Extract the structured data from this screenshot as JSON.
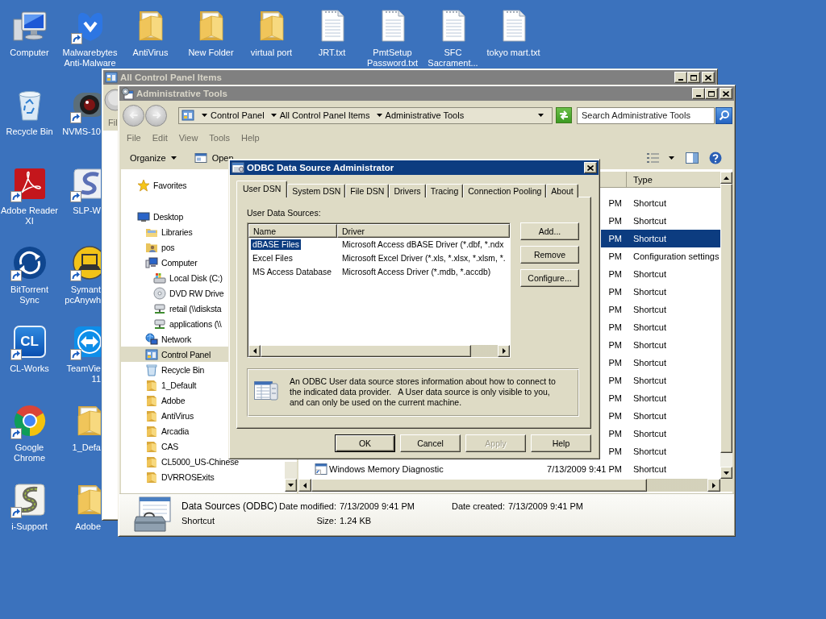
{
  "desktop": {
    "columns": [
      {
        "icons": [
          {
            "label": "Computer",
            "kind": "computer",
            "shortcut": false
          },
          {
            "label": "Recycle Bin",
            "kind": "recycle",
            "shortcut": false
          },
          {
            "label": "Adobe Reader XI",
            "kind": "pdf",
            "shortcut": true
          },
          {
            "label": "BitTorrent Sync",
            "kind": "sync",
            "shortcut": true
          },
          {
            "label": "CL-Works",
            "kind": "tile",
            "logo": "CL",
            "shortcut": true
          },
          {
            "label": "Google Chrome",
            "kind": "chrome",
            "shortcut": true
          },
          {
            "label": "i-Support",
            "kind": "road",
            "shortcut": true
          }
        ]
      },
      {
        "icons": [
          {
            "label": "Malwarebytes Anti-Malware",
            "kind": "emblem",
            "shortcut": true
          },
          {
            "label": "NVMS-10",
            "kind": "camera",
            "shortcut": true
          },
          {
            "label": "SLP-W",
            "kind": "swoosh",
            "shortcut": true
          },
          {
            "label": "Symant pcAnywh",
            "kind": "laptop",
            "shortcut": true
          },
          {
            "label": "TeamVie 11",
            "kind": "arrows",
            "shortcut": true
          },
          {
            "label": "1_Defa",
            "kind": "folder",
            "shortcut": false
          },
          {
            "label": "Adobe",
            "kind": "folder",
            "shortcut": false
          }
        ]
      },
      {
        "icons": [
          {
            "label": "AntiVirus",
            "kind": "folder",
            "shortcut": false
          }
        ]
      },
      {
        "icons": [
          {
            "label": "New Folder",
            "kind": "folder",
            "shortcut": false
          }
        ]
      },
      {
        "icons": [
          {
            "label": "virtual port",
            "kind": "folder",
            "shortcut": false
          }
        ]
      },
      {
        "icons": [
          {
            "label": "JRT.txt",
            "kind": "text",
            "shortcut": false
          }
        ]
      },
      {
        "icons": [
          {
            "label": "PmtSetup Password.txt",
            "kind": "text",
            "shortcut": false
          }
        ]
      },
      {
        "icons": [
          {
            "label": "SFC Sacrament...",
            "kind": "text",
            "shortcut": false
          }
        ]
      },
      {
        "icons": [
          {
            "label": "tokyo mart.txt",
            "kind": "text",
            "shortcut": false
          }
        ]
      }
    ]
  },
  "back_window": {
    "title": "All Control Panel Items",
    "active": false,
    "menu": [
      "Fil"
    ]
  },
  "explorer": {
    "title": "Administrative Tools",
    "active": false,
    "breadcrumb": [
      "Control Panel",
      "All Control Panel Items",
      "Administrative Tools"
    ],
    "search": {
      "placeholder": "Search Administrative Tools"
    },
    "menu": [
      "File",
      "Edit",
      "View",
      "Tools",
      "Help"
    ],
    "toolbar": [
      {
        "label": "Organize",
        "kind": "menu"
      },
      {
        "label": "Open",
        "kind": "open"
      }
    ],
    "nav": [
      {
        "label": "Favorites",
        "kind": "star",
        "selected": false
      },
      {
        "label": "Desktop",
        "kind": "desktop",
        "selected": false,
        "children": [
          {
            "label": "Libraries",
            "kind": "libraries",
            "selected": false
          },
          {
            "label": "pos",
            "kind": "user",
            "selected": false
          },
          {
            "label": "Computer",
            "kind": "computer",
            "selected": false,
            "children": [
              {
                "label": "Local Disk (C:)",
                "kind": "disk",
                "selected": false
              },
              {
                "label": "DVD RW Drive",
                "kind": "dvd",
                "selected": false
              },
              {
                "label": "retail (\\\\disksta",
                "kind": "netdrive",
                "selected": false
              },
              {
                "label": "applications (\\\\",
                "kind": "netdrive",
                "selected": false
              }
            ]
          },
          {
            "label": "Network",
            "kind": "network",
            "selected": false
          },
          {
            "label": "Control Panel",
            "kind": "controlpanel",
            "selected": true
          },
          {
            "label": "Recycle Bin",
            "kind": "recycle",
            "selected": false
          },
          {
            "label": "1_Default",
            "kind": "folder",
            "selected": false
          },
          {
            "label": "Adobe",
            "kind": "folder",
            "selected": false
          },
          {
            "label": "AntiVirus",
            "kind": "folder",
            "selected": false
          },
          {
            "label": "Arcadia",
            "kind": "folder",
            "selected": false
          },
          {
            "label": "CAS",
            "kind": "folder",
            "selected": false
          },
          {
            "label": "CL5000_US-Chinese",
            "kind": "folder",
            "selected": false
          },
          {
            "label": "DVRROSExits",
            "kind": "folder",
            "selected": false
          }
        ]
      }
    ],
    "file_list": {
      "type_header": "Type",
      "rows": [
        {
          "date": "PM",
          "type": "Shortcut",
          "selected": false
        },
        {
          "date": "PM",
          "type": "Shortcut",
          "selected": false
        },
        {
          "date": "PM",
          "type": "Shortcut",
          "selected": true
        },
        {
          "date": "PM",
          "type": "Configuration settings",
          "selected": false
        },
        {
          "date": "PM",
          "type": "Shortcut",
          "selected": false
        },
        {
          "date": "PM",
          "type": "Shortcut",
          "selected": false
        },
        {
          "date": "PM",
          "type": "Shortcut",
          "selected": false
        },
        {
          "date": "PM",
          "type": "Shortcut",
          "selected": false
        },
        {
          "date": "PM",
          "type": "Shortcut",
          "selected": false
        },
        {
          "date": "PM",
          "type": "Shortcut",
          "selected": false
        },
        {
          "date": "PM",
          "type": "Shortcut",
          "selected": false
        },
        {
          "date": "PM",
          "type": "Shortcut",
          "selected": false
        },
        {
          "date": "PM",
          "type": "Shortcut",
          "selected": false
        },
        {
          "date": "PM",
          "type": "Shortcut",
          "selected": false
        },
        {
          "date": "PM",
          "type": "Shortcut",
          "selected": false
        },
        {
          "name": "Windows Memory Diagnostic",
          "date": "7/13/2009 9:41 PM",
          "type": "Shortcut",
          "selected": false
        }
      ]
    },
    "details": {
      "name": "Data Sources (ODBC)",
      "type": "Shortcut",
      "fields": [
        {
          "label": "Date modified:",
          "value": "7/13/2009 9:41 PM"
        },
        {
          "label": "Date created:",
          "value": "7/13/2009 9:41 PM"
        },
        {
          "label": "Size:",
          "value": "1.24 KB"
        }
      ]
    }
  },
  "odbc_dialog": {
    "title": "ODBC Data Source Administrator",
    "active": true,
    "tabs": [
      {
        "label": "User DSN",
        "selected": true
      },
      {
        "label": "System DSN",
        "selected": false
      },
      {
        "label": "File DSN",
        "selected": false
      },
      {
        "label": "Drivers",
        "selected": false
      },
      {
        "label": "Tracing",
        "selected": false
      },
      {
        "label": "Connection Pooling",
        "selected": false
      },
      {
        "label": "About",
        "selected": false
      }
    ],
    "list_label": "User Data Sources:",
    "columns": [
      "Name",
      "Driver"
    ],
    "rows": [
      {
        "name": "dBASE Files",
        "driver": "Microsoft Access dBASE Driver (*.dbf, *.ndx",
        "selected": true
      },
      {
        "name": "Excel Files",
        "driver": "Microsoft Excel Driver (*.xls, *.xlsx, *.xlsm, *.",
        "selected": false
      },
      {
        "name": "MS Access Database",
        "driver": "Microsoft Access Driver (*.mdb, *.accdb)",
        "selected": false
      }
    ],
    "side_buttons": [
      "Add...",
      "Remove",
      "Configure..."
    ],
    "info": "An ODBC User data source stores information about how to connect to the indicated data provider.   A User data source is only visible to you, and can only be used on the current machine.",
    "buttons": [
      {
        "label": "OK",
        "default": true,
        "disabled": false
      },
      {
        "label": "Cancel",
        "default": false,
        "disabled": false
      },
      {
        "label": "Apply",
        "default": false,
        "disabled": true
      },
      {
        "label": "Help",
        "default": false,
        "disabled": false
      }
    ]
  }
}
